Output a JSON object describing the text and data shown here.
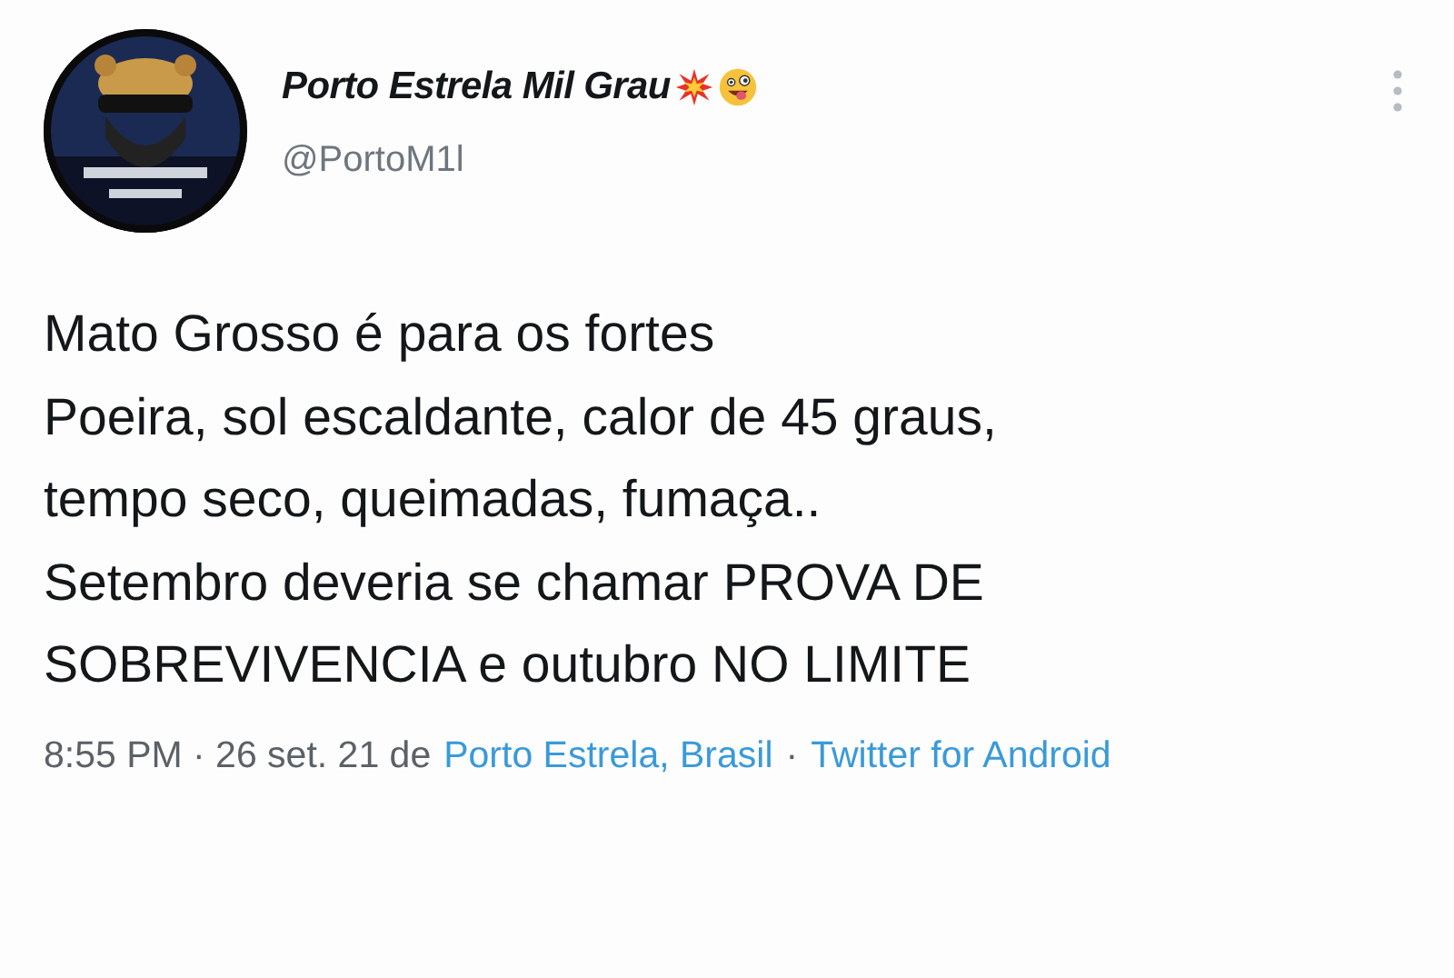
{
  "author": {
    "name": "Porto Estrela Mil Grau",
    "handle": "@PortoM1l"
  },
  "tweet": {
    "paragraphs": [
      "Mato Grosso é para os fortes",
      "Poeira, sol escaldante, calor de 45 graus, tempo seco, queimadas, fumaça..",
      "Setembro deveria se chamar PROVA DE SOBREVIVENCIA e outubro NO LIMITE"
    ]
  },
  "meta": {
    "time": "8:55 PM · 26 set. 21 de",
    "location": "Porto Estrela, Brasil",
    "separator": "·",
    "source": "Twitter for Android"
  }
}
